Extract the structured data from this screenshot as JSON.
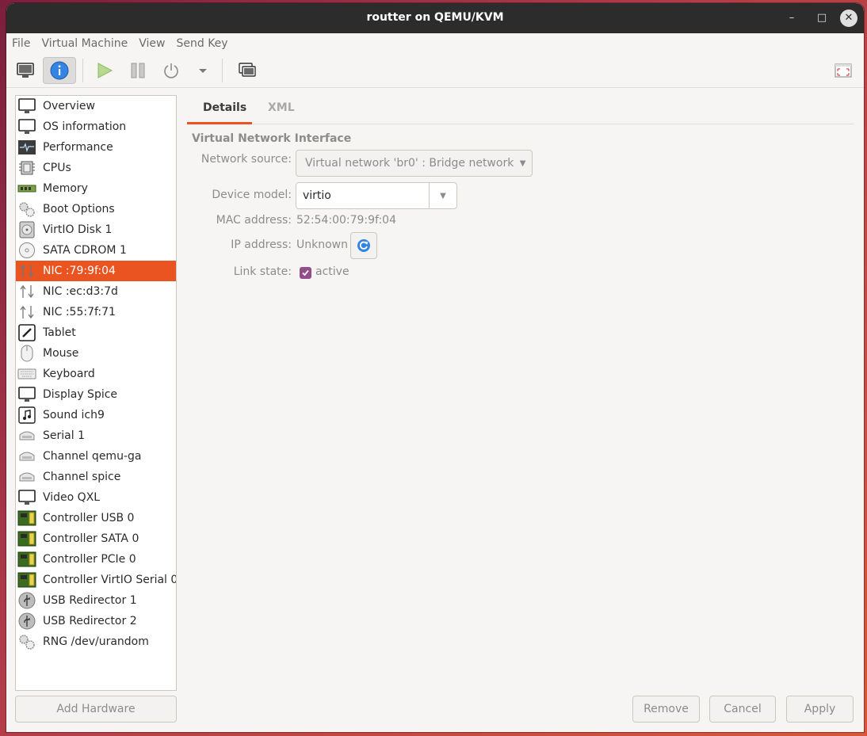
{
  "window": {
    "title": "routter on QEMU/KVM",
    "min": "–",
    "max": "□",
    "close": "✕"
  },
  "menu": [
    "File",
    "Virtual Machine",
    "View",
    "Send Key"
  ],
  "toolbar": {
    "items": [
      "console-icon",
      "details-icon",
      "run-icon",
      "pause-icon",
      "shutdown-icon",
      "shutdown-menu-icon",
      "snapshots-icon",
      "fullscreen-icon"
    ]
  },
  "sidebar": {
    "selected_index": 8,
    "items": [
      {
        "label": "Overview",
        "icon": "monitor-icon"
      },
      {
        "label": "OS information",
        "icon": "monitor-icon"
      },
      {
        "label": "Performance",
        "icon": "performance-icon"
      },
      {
        "label": "CPUs",
        "icon": "cpu-icon"
      },
      {
        "label": "Memory",
        "icon": "memory-icon"
      },
      {
        "label": "Boot Options",
        "icon": "gears-icon"
      },
      {
        "label": "VirtIO Disk 1",
        "icon": "disk-icon"
      },
      {
        "label": "SATA CDROM 1",
        "icon": "cdrom-icon"
      },
      {
        "label": "NIC :79:9f:04",
        "icon": "nic-icon"
      },
      {
        "label": "NIC :ec:d3:7d",
        "icon": "nic-icon"
      },
      {
        "label": "NIC :55:7f:71",
        "icon": "nic-icon"
      },
      {
        "label": "Tablet",
        "icon": "tablet-icon"
      },
      {
        "label": "Mouse",
        "icon": "mouse-icon"
      },
      {
        "label": "Keyboard",
        "icon": "keyboard-icon"
      },
      {
        "label": "Display Spice",
        "icon": "monitor-icon"
      },
      {
        "label": "Sound ich9",
        "icon": "sound-icon"
      },
      {
        "label": "Serial 1",
        "icon": "serial-icon"
      },
      {
        "label": "Channel qemu-ga",
        "icon": "serial-icon"
      },
      {
        "label": "Channel spice",
        "icon": "serial-icon"
      },
      {
        "label": "Video QXL",
        "icon": "monitor-icon"
      },
      {
        "label": "Controller USB 0",
        "icon": "controller-icon"
      },
      {
        "label": "Controller SATA 0",
        "icon": "controller-icon"
      },
      {
        "label": "Controller PCIe 0",
        "icon": "controller-icon"
      },
      {
        "label": "Controller VirtIO Serial 0",
        "icon": "controller-icon"
      },
      {
        "label": "USB Redirector 1",
        "icon": "usb-icon"
      },
      {
        "label": "USB Redirector 2",
        "icon": "usb-icon"
      },
      {
        "label": "RNG /dev/urandom",
        "icon": "gears-icon"
      }
    ],
    "add_hardware": "Add Hardware"
  },
  "tabs": [
    "Details",
    "XML"
  ],
  "details": {
    "section_title": "Virtual Network Interface",
    "network_source_label": "Network source:",
    "network_source_value": "Virtual network 'br0' : Bridge network",
    "device_model_label": "Device model:",
    "device_model_value": "virtio",
    "mac_label": "MAC address:",
    "mac_value": "52:54:00:79:9f:04",
    "ip_label": "IP address:",
    "ip_value": "Unknown",
    "link_label": "Link state:",
    "link_value": "active",
    "link_checked": true
  },
  "buttons": {
    "remove": "Remove",
    "cancel": "Cancel",
    "apply": "Apply"
  },
  "colors": {
    "accent": "#e95420",
    "check": "#924d8b",
    "info": "#3584e4"
  }
}
